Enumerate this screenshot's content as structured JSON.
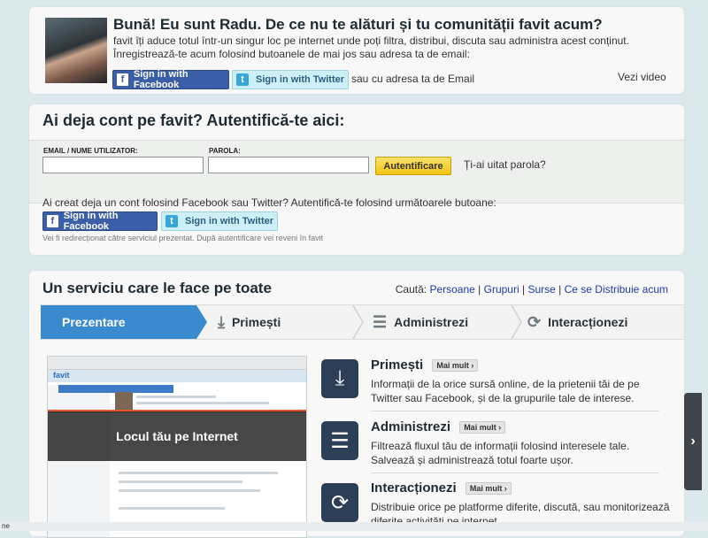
{
  "welcome": {
    "title": "Bună! Eu sunt Radu. De ce nu te alături și tu comunității favit acum?",
    "line1": "favit îți aduce totul într-un singur loc pe internet unde poți filtra, distribui, discuta sau administra acest conținut.",
    "line2": "Înregistrează-te acum folosind butoanele de mai jos sau adresa ta de email:",
    "fb_label": "Sign in with Facebook",
    "tw_label": "Sign in with Twitter",
    "or_text": "sau",
    "email_link": "cu adresa ta de Email",
    "video_link": "Vezi video"
  },
  "login": {
    "title": "Ai deja cont pe favit? Autentifică-te aici:",
    "email_label": "EMAIL / NUME UTILIZATOR:",
    "password_label": "PAROLA:",
    "email_value": "",
    "password_value": "",
    "submit_label": "Autentificare",
    "forgot_link": "Ți-ai uitat parola?",
    "social_prompt": "Ai creat deja un cont folosind Facebook sau Twitter? Autentifică-te folosind următoarele butoane:",
    "fb_label": "Sign in with Facebook",
    "tw_label": "Sign in with Twitter",
    "redirect_note": "Vei fi redirecționat către serviciul prezentat. După autentificare vei reveni în favit"
  },
  "service": {
    "title": "Un serviciu care le face pe toate",
    "search_label": "Caută:",
    "search_links": [
      "Persoane",
      "Grupuri",
      "Surse",
      "Ce se Distribuie acum"
    ],
    "separator": "|",
    "tabs": [
      "Prezentare",
      "Primești",
      "Administrezi",
      "Interacționezi"
    ],
    "preview_caption": "Locul tău pe Internet",
    "preview_logo": "favit",
    "more_label": "Mai mult",
    "features": [
      {
        "title": "Primești",
        "desc": "Informații de la orice sursă online, de la prietenii tăi de pe Twitter sau Facebook, și de la grupurile tale de interese.",
        "icon": "download-icon"
      },
      {
        "title": "Administrezi",
        "desc": "Filtrează fluxul tău de informații folosind interesele tale. Salvează și administrează totul foarte ușor.",
        "icon": "list-icon"
      },
      {
        "title": "Interacționezi",
        "desc": "Distribuie orice pe platforme diferite, discută, sau monitorizează diferite activități pe internet.",
        "icon": "sync-icon"
      }
    ]
  },
  "side_handle": "›",
  "status_text": "ne",
  "colors": {
    "accent": "#3a8ad0",
    "facebook": "#3b5ea8",
    "twitter_bg": "#cdeff7",
    "login_button": "#f1c313",
    "link": "#1f3aa8"
  }
}
